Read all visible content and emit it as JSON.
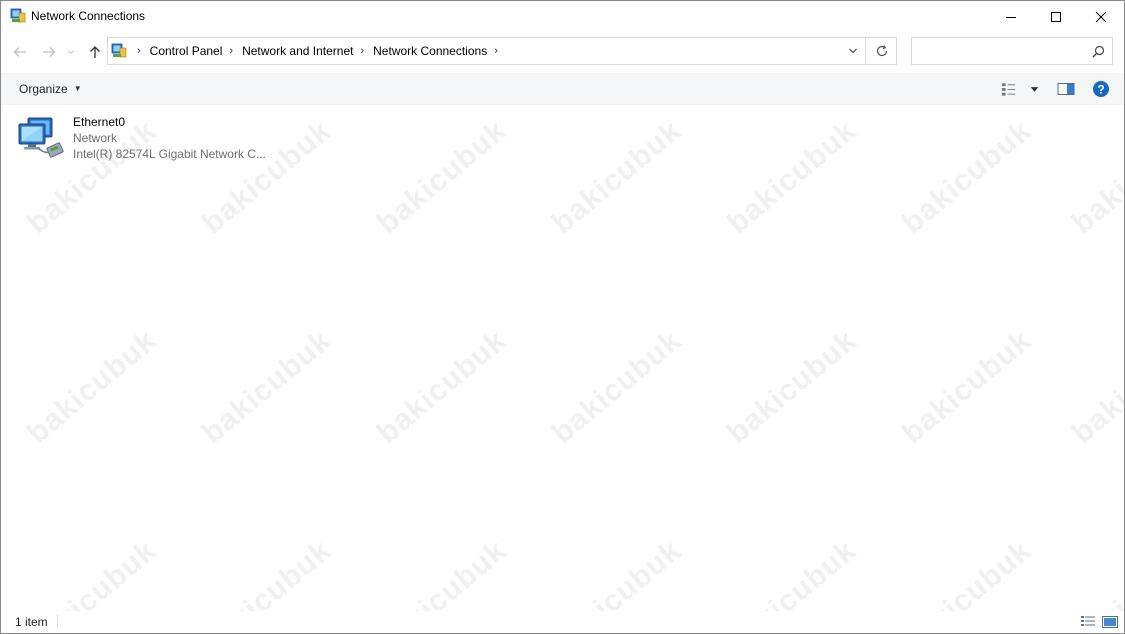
{
  "window": {
    "title": "Network Connections",
    "accent": "#0078d7"
  },
  "caption": {
    "minimize": "minimize-icon",
    "maximize": "maximize-icon",
    "close": "close-icon"
  },
  "address": {
    "breadcrumbs": [
      "Control Panel",
      "Network and Internet",
      "Network Connections"
    ]
  },
  "search": {
    "value": "",
    "placeholder": ""
  },
  "commandbar": {
    "organize_label": "Organize"
  },
  "items": [
    {
      "name": "Ethernet0",
      "network": "Network",
      "adapter": "Intel(R) 82574L Gigabit Network C..."
    }
  ],
  "status": {
    "count": "1 item"
  },
  "watermark": "bakicubuk"
}
